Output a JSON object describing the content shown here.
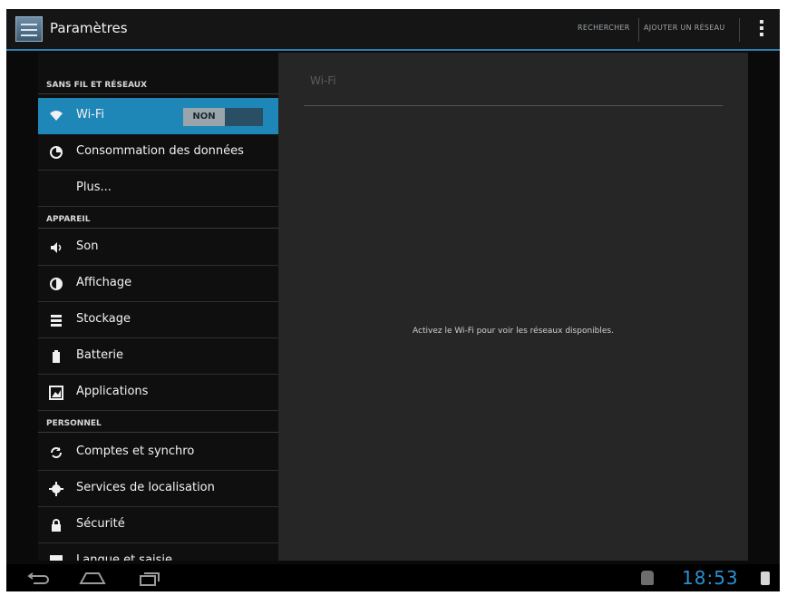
{
  "actionbar": {
    "app_icon": "settings-app-icon",
    "title": "Paramètres",
    "search_label": "RECHERCHER",
    "add_network_label": "AJOUTER UN RÉSEAU",
    "overflow_icon": "overflow-menu-icon"
  },
  "sidebar": {
    "sections": [
      {
        "header": "SANS FIL ET RÉSEAUX",
        "items": [
          {
            "label": "Wi-Fi",
            "icon": "wifi-icon",
            "selected": true,
            "toggle": "NON"
          },
          {
            "label": "Consommation des données",
            "icon": "data-usage-icon"
          },
          {
            "label": "Plus...",
            "icon": ""
          }
        ]
      },
      {
        "header": "APPAREIL",
        "items": [
          {
            "label": "Son",
            "icon": "sound-icon"
          },
          {
            "label": "Affichage",
            "icon": "display-icon"
          },
          {
            "label": "Stockage",
            "icon": "storage-icon"
          },
          {
            "label": "Batterie",
            "icon": "battery-icon"
          },
          {
            "label": "Applications",
            "icon": "applications-icon"
          }
        ]
      },
      {
        "header": "PERSONNEL",
        "items": [
          {
            "label": "Comptes et synchro",
            "icon": "sync-icon"
          },
          {
            "label": "Services de localisation",
            "icon": "location-icon"
          },
          {
            "label": "Sécurité",
            "icon": "lock-icon"
          },
          {
            "label": "Langue et saisie",
            "icon": "language-icon"
          }
        ]
      }
    ]
  },
  "detail": {
    "title": "Wi-Fi",
    "message": "Activez le Wi-Fi pour voir les réseaux disponibles."
  },
  "systembar": {
    "back_icon": "back-icon",
    "home_icon": "home-icon",
    "recent_icon": "recent-apps-icon",
    "status_icon": "android-debug-icon",
    "clock": "18:53",
    "user_icon": "user-icon"
  },
  "colors": {
    "accent": "#1f86b8",
    "clock": "#2c8fd0"
  }
}
